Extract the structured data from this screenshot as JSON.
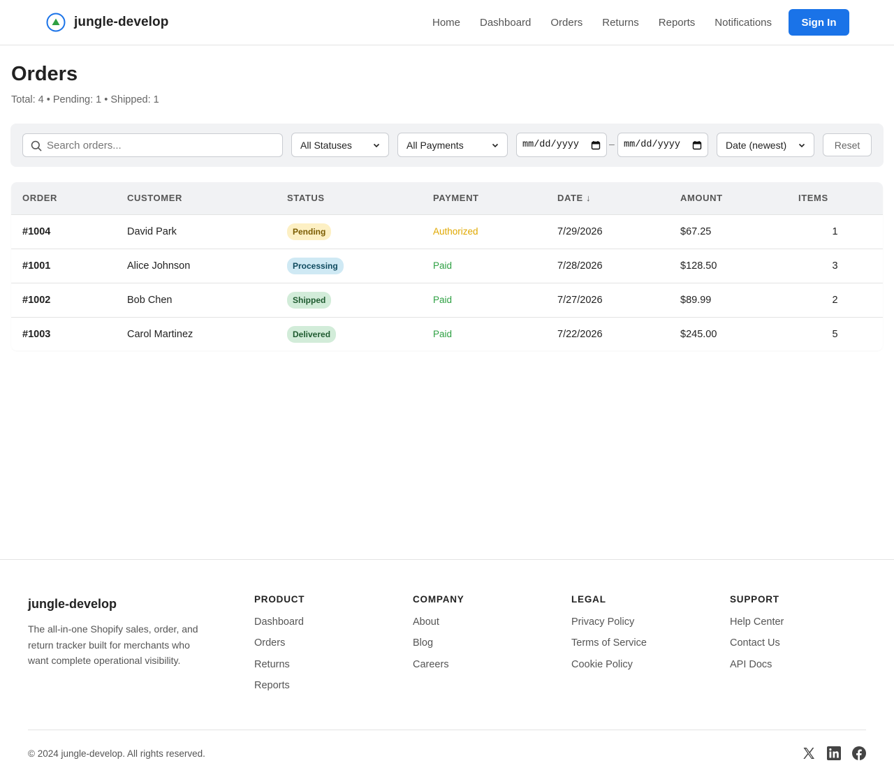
{
  "header": {
    "brand": "jungle-develop",
    "nav": [
      "Home",
      "Dashboard",
      "Orders",
      "Returns",
      "Reports",
      "Notifications"
    ],
    "signin_label": "Sign In",
    "accent_color": "#1a73e8"
  },
  "page": {
    "title": "Orders",
    "summary": "Total: 4 • Pending: 1 • Shipped: 1"
  },
  "filters": {
    "search_placeholder": "Search orders...",
    "status_selected": "All Statuses",
    "payment_selected": "All Payments",
    "date_from_placeholder": "mm/dd/yyyy",
    "date_separator": "–",
    "date_to_placeholder": "mm/dd/yyyy",
    "sort_selected": "Date (newest)",
    "reset_label": "Reset"
  },
  "table": {
    "columns": [
      "ORDER",
      "CUSTOMER",
      "STATUS",
      "PAYMENT",
      "DATE ↓",
      "AMOUNT",
      "ITEMS"
    ],
    "rows": [
      {
        "order": "#1004",
        "customer": "David Park",
        "status": "Pending",
        "payment": "Authorized",
        "date": "7/29/2026",
        "amount": "$67.25",
        "items": "1"
      },
      {
        "order": "#1001",
        "customer": "Alice Johnson",
        "status": "Processing",
        "payment": "Paid",
        "date": "7/28/2026",
        "amount": "$128.50",
        "items": "3"
      },
      {
        "order": "#1002",
        "customer": "Bob Chen",
        "status": "Shipped",
        "payment": "Paid",
        "date": "7/27/2026",
        "amount": "$89.99",
        "items": "2"
      },
      {
        "order": "#1003",
        "customer": "Carol Martinez",
        "status": "Delivered",
        "payment": "Paid",
        "date": "7/22/2026",
        "amount": "$245.00",
        "items": "5"
      }
    ],
    "status_colors": {
      "Pending": {
        "bg": "#fdf0c4",
        "fg": "#7a5b00"
      },
      "Processing": {
        "bg": "#cfe9f4",
        "fg": "#0f4a5f"
      },
      "Shipped": {
        "bg": "#d2ecd9",
        "fg": "#1f5b30"
      },
      "Delivered": {
        "bg": "#d2ecd9",
        "fg": "#1f5b30"
      }
    },
    "payment_colors": {
      "Authorized": "#e0a800",
      "Paid": "#2ea043"
    }
  },
  "footer": {
    "brand": "jungle-develop",
    "description": "The all-in-one Shopify sales, order, and return tracker built for merchants who want complete operational visibility.",
    "columns": [
      {
        "heading": "PRODUCT",
        "links": [
          "Dashboard",
          "Orders",
          "Returns",
          "Reports"
        ]
      },
      {
        "heading": "COMPANY",
        "links": [
          "About",
          "Blog",
          "Careers"
        ]
      },
      {
        "heading": "LEGAL",
        "links": [
          "Privacy Policy",
          "Terms of Service",
          "Cookie Policy"
        ]
      },
      {
        "heading": "SUPPORT",
        "links": [
          "Help Center",
          "Contact Us",
          "API Docs"
        ]
      }
    ],
    "copyright": "© 2024 jungle-develop. All rights reserved.",
    "socials": [
      "x-icon",
      "linkedin-icon",
      "facebook-icon"
    ]
  }
}
